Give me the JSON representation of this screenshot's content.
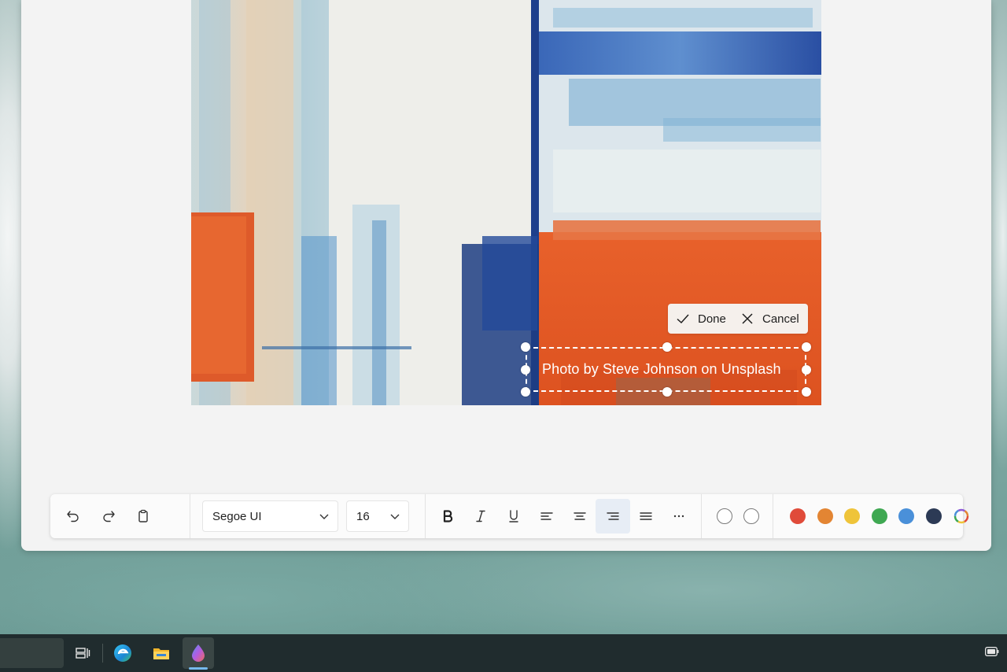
{
  "canvas": {
    "caption_text": "Photo by Steve Johnson on Unsplash"
  },
  "edit_actions": {
    "done_label": "Done",
    "cancel_label": "Cancel"
  },
  "toolbar": {
    "undo_icon": "undo-icon",
    "redo_icon": "redo-icon",
    "clipboard_icon": "clipboard-icon",
    "font_family": "Segoe UI",
    "font_size": "16",
    "format_buttons": [
      "bold",
      "italic",
      "underline",
      "align-left",
      "align-center",
      "align-right",
      "justify",
      "more"
    ],
    "active_alignment": "align-right",
    "outline_swatches": [
      "no-fill",
      "outline"
    ],
    "colors": [
      "#e04b3a",
      "#e38533",
      "#efc43a",
      "#3fa852",
      "#4a90d9",
      "#2c3a55"
    ],
    "custom_color_icon": "color-picker-icon"
  },
  "taskbar": {
    "icons": [
      "task-view-icon",
      "edge-icon",
      "file-explorer-icon",
      "paint-app-icon"
    ],
    "active_app": "paint-app-icon",
    "tray_icon": "battery-icon"
  }
}
